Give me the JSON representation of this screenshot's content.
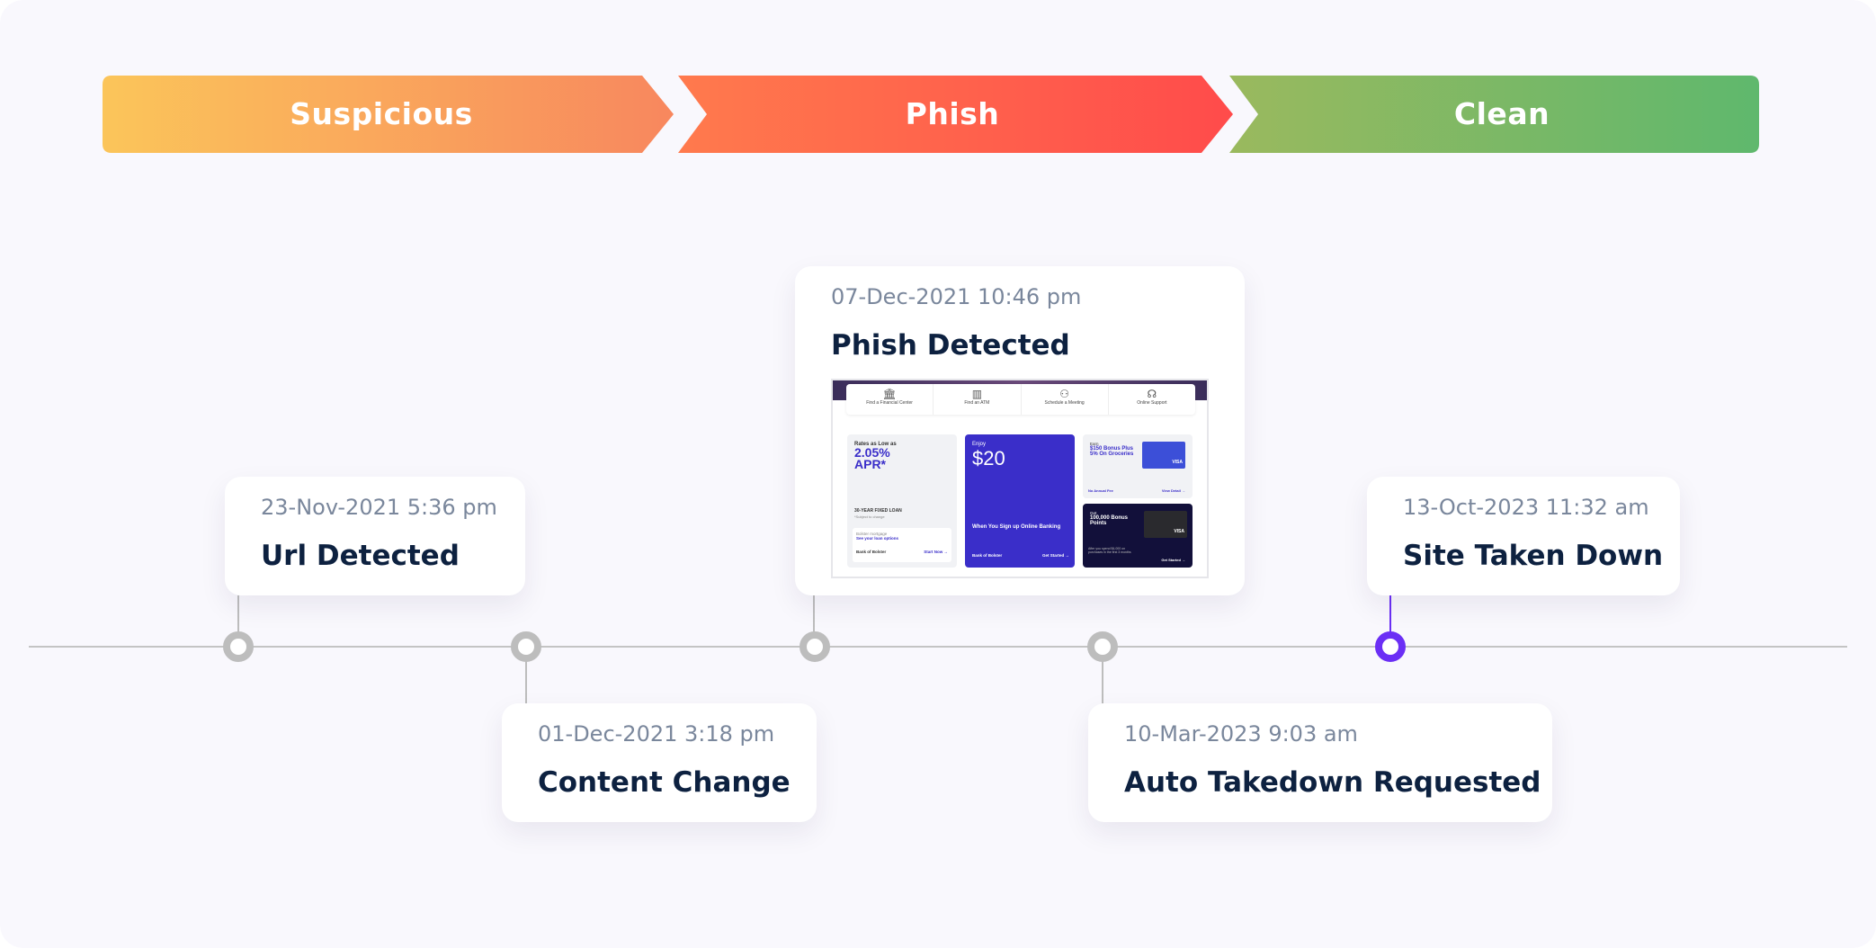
{
  "stages": [
    {
      "label": "Suspicious",
      "colors": [
        "#fbc55a",
        "#f8875e"
      ]
    },
    {
      "label": "Phish",
      "colors": [
        "#ff7a4d",
        "#ff4b4b"
      ]
    },
    {
      "label": "Clean",
      "colors": [
        "#9ab95e",
        "#5fb86d"
      ]
    }
  ],
  "events": [
    {
      "date": "23-Nov-2021 5:36 pm",
      "title": "Url Detected"
    },
    {
      "date": "01-Dec-2021 3:18 pm",
      "title": "Content Change"
    },
    {
      "date": "07-Dec-2021 10:46 pm",
      "title": "Phish Detected"
    },
    {
      "date": "10-Mar-2023 9:03 am",
      "title": "Auto Takedown Requested"
    },
    {
      "date": "13-Oct-2023 11:32 am",
      "title": "Site Taken Down"
    }
  ],
  "active_color": "#6b2ff5",
  "thumbnail": {
    "nav": [
      "Find a Financial Center",
      "Find an ATM",
      "Schedule a Meeting",
      "Online Support"
    ],
    "tile1": {
      "pre": "Rates as Low as",
      "rate": "2.05%",
      "apr": "APR*",
      "loan": "30-YEAR FIXED LOAN",
      "note": "*Subject to change",
      "sub": "Bolster mortgage",
      "link": "See your loan options",
      "brand": "Bank of Bolster",
      "cta": "Start Now →"
    },
    "tile2": {
      "pre": "Enjoy",
      "amount": "$20",
      "text": "When You Sign up Online Banking",
      "brand": "Bank of Bolster",
      "cta": "Get Started →"
    },
    "tile3": {
      "pre": "Earn",
      "text": "$150 Bonus Plus 5% On Groceries",
      "fee": "No Annual Fee",
      "cta": "View Detail →",
      "card": "VISA"
    },
    "tile4": {
      "pre": "Get",
      "text": "100,000 Bonus Points",
      "note": "After you spend $4,000 on purchases in the first 3 months",
      "cta": "Get Started →",
      "card": "VISA"
    }
  }
}
